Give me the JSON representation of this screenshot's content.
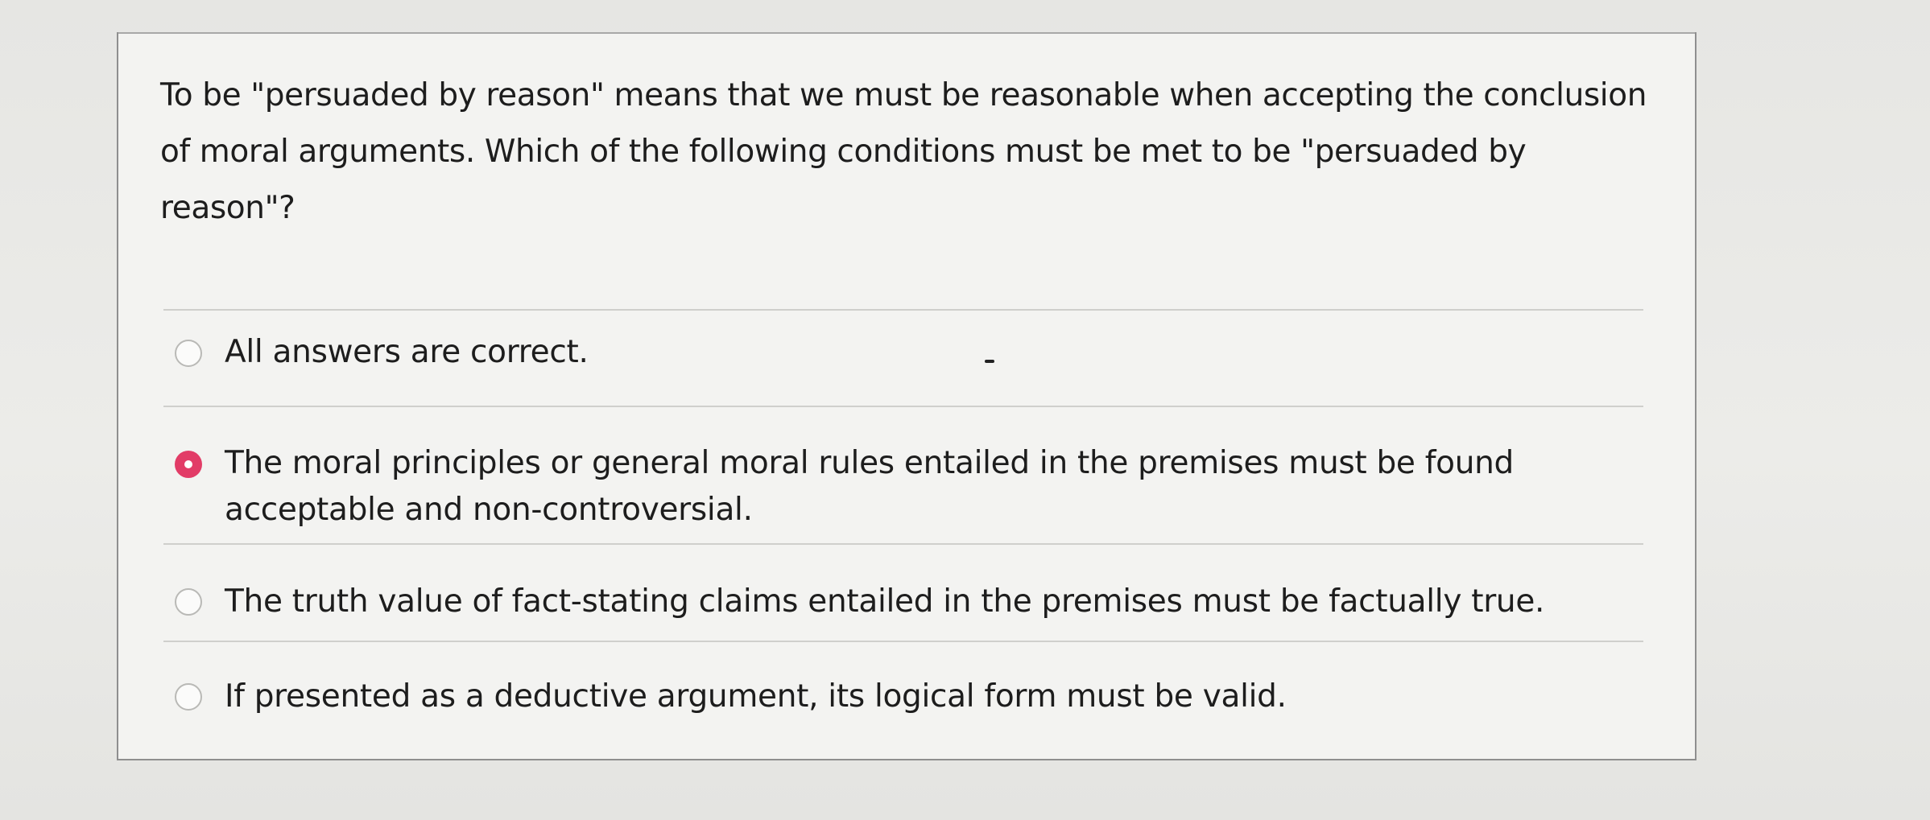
{
  "question": {
    "prompt": "To be \"persuaded by reason\" means that we must be reasonable when accepting the conclusion of moral arguments. Which of the following conditions must be met to be \"persuaded by reason\"?"
  },
  "options": [
    {
      "label": "All answers are correct.",
      "selected": false
    },
    {
      "label": "The moral principles or general moral rules entailed in the premises must be found acceptable and non-controversial.",
      "selected": true
    },
    {
      "label": "The truth value of fact-stating claims entailed in the premises must be factually true.",
      "selected": false
    },
    {
      "label": "If presented as a deductive argument, its logical form must be valid.",
      "selected": false
    }
  ],
  "colors": {
    "selected_radio": "#e23c67",
    "card_background": "#f3f3f1",
    "text": "#1d1d1d"
  }
}
